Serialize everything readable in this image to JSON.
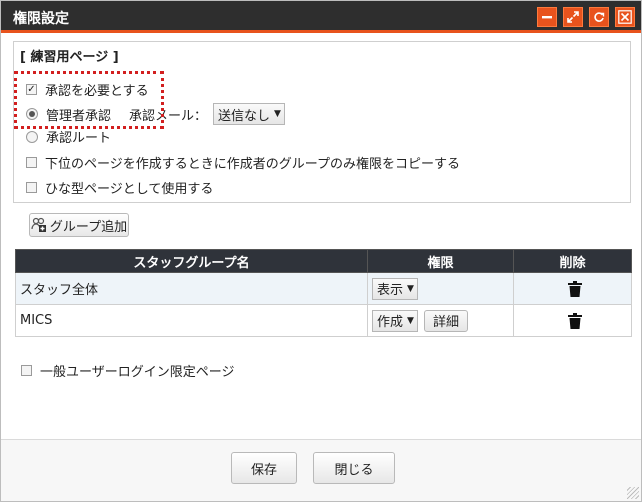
{
  "window": {
    "title": "権限設定",
    "buttons": [
      "minimize-icon",
      "maximize-icon",
      "refresh-icon",
      "close-icon"
    ],
    "accent": "#e8531d",
    "titlebar_bg": "#2e2e2e"
  },
  "page_section": {
    "title": "[ 練習用ページ ]",
    "require_approval": {
      "label": "承認を必要とする",
      "checked": true
    },
    "admin_approval": {
      "label": "管理者承認",
      "selected": true
    },
    "approval_mail": {
      "label": "承認メール：",
      "value": "送信なし"
    },
    "approval_route": {
      "label": "承認ルート",
      "selected": false
    },
    "copy_group_only": {
      "label": "下位のページを作成するときに作成者のグループのみ権限をコピーする",
      "checked": false
    },
    "use_as_template": {
      "label": "ひな型ページとして使用する",
      "checked": false
    }
  },
  "add_group_button": {
    "label": "グループ追加"
  },
  "table": {
    "headers": [
      "スタッフグループ名",
      "権限",
      "削除"
    ],
    "rows": [
      {
        "name": "スタッフ全体",
        "permission": "表示",
        "has_detail": false
      },
      {
        "name": "MICS",
        "permission": "作成",
        "has_detail": true,
        "detail_label": "詳細"
      }
    ]
  },
  "login_limited": {
    "label": "一般ユーザーログイン限定ページ",
    "checked": false
  },
  "footer": {
    "save_label": "保存",
    "close_label": "閉じる"
  }
}
